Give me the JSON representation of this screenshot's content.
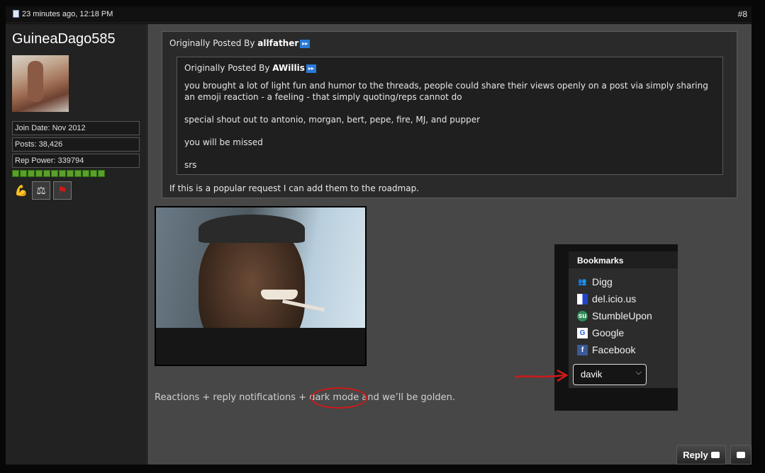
{
  "post": {
    "timestamp": "23 minutes ago, 12:18 PM",
    "number": "#8"
  },
  "user": {
    "name": "GuineaDago585",
    "join_date": "Join Date: Nov 2012",
    "posts": "Posts: 38,426",
    "rep_power": "Rep Power: 339794",
    "rep_blocks": 12
  },
  "quote_outer": {
    "prefix": "Originally Posted By",
    "author": "allfather",
    "tail": "If this is a popular request I can add them to the roadmap."
  },
  "quote_inner": {
    "prefix": "Originally Posted By",
    "author": "AWillis",
    "paragraphs": [
      "you brought a lot of light fun and humor to the threads, people could share their views openly on a post via simply sharing an emoji reaction - a feeling - that simply quoting/reps cannot do",
      "special shout out to antonio, morgan, bert, pepe, fire, MJ, and pupper",
      "you will be missed",
      "srs"
    ]
  },
  "reaction": {
    "before": "Reactions + reply notifications +",
    "circled": "dark mode",
    "after": "and we’ll be golden."
  },
  "bookmarks": {
    "title": "Bookmarks",
    "items": [
      "Digg",
      "del.icio.us",
      "StumbleUpon",
      "Google",
      "Facebook"
    ],
    "selected_user": "davik"
  },
  "buttons": {
    "reply": "Reply"
  },
  "colors": {
    "annotation": "#d01818",
    "rep": "#5aa02a",
    "link_icon": "#2a7ad8"
  }
}
